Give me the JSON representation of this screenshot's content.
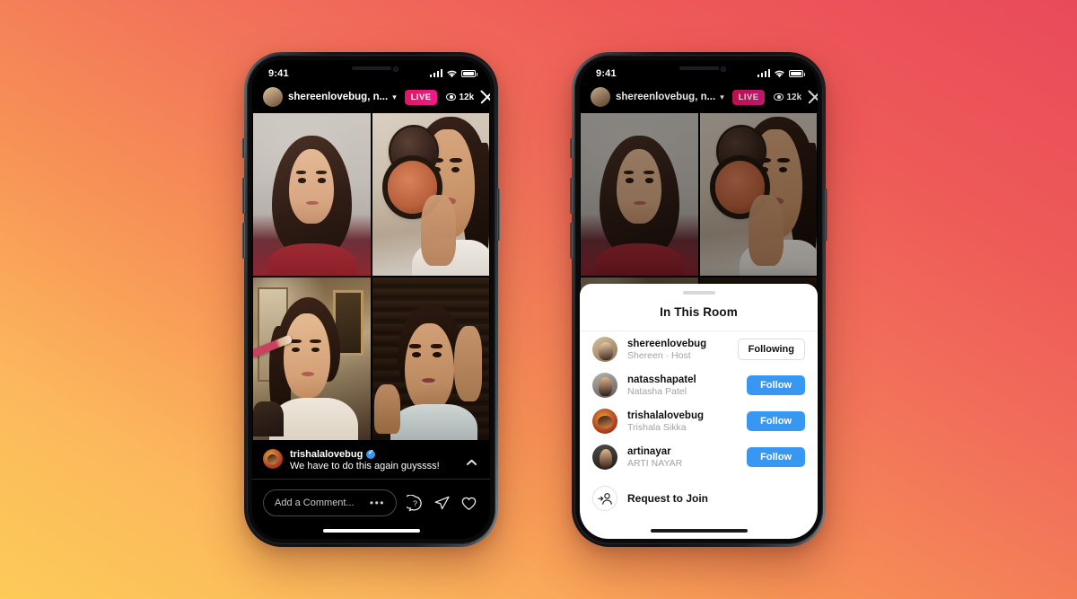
{
  "background": {
    "gradient_from": "#fdcb58",
    "gradient_to": "#e94a5a"
  },
  "accent": {
    "live_badge": "#ee1b8d",
    "follow_blue": "#3897f0",
    "verified_blue": "#3897f0"
  },
  "phones": [
    {
      "id": "left-phone",
      "status_bar": {
        "time": "9:41",
        "signal": "signal-bars-icon",
        "wifi": "wifi-icon",
        "battery": "battery-icon"
      },
      "live_header": {
        "avatar": "host-avatar",
        "username": "shereenlovebug, n...",
        "chevron": "chevron-down-icon",
        "live_label": "LIVE",
        "viewer_icon": "eye-icon",
        "viewer_count": "12k",
        "close": "close-icon"
      },
      "grid": [
        {
          "name": "participant-tile-1",
          "alt": "woman in red top, light wall"
        },
        {
          "name": "participant-tile-2",
          "alt": "woman holding makeup compact"
        },
        {
          "name": "participant-tile-3",
          "alt": "woman applying eye makeup with brush"
        },
        {
          "name": "participant-tile-4",
          "alt": "woman touching brow, dark blinds"
        }
      ],
      "comment": {
        "avatar": "commenter-avatar",
        "username": "trishalalovebug",
        "verified": true,
        "text": "We have to do this again guyssss!",
        "collapse": "chevron-up-icon"
      },
      "action_bar": {
        "input_placeholder": "Add a Comment...",
        "more": "ellipsis-icon",
        "icons": [
          "question-circle-icon",
          "share-icon",
          "heart-icon"
        ]
      },
      "home_indicator": "home-indicator"
    },
    {
      "id": "right-phone",
      "status_bar": {
        "time": "9:41",
        "signal": "signal-bars-icon",
        "wifi": "wifi-icon",
        "battery": "battery-icon"
      },
      "live_header": {
        "avatar": "host-avatar",
        "username": "shereenlovebug, n...",
        "chevron": "chevron-down-icon",
        "live_label": "LIVE",
        "viewer_icon": "eye-icon",
        "viewer_count": "12k",
        "close": "close-icon"
      },
      "sheet": {
        "handle": "drag-handle",
        "title": "In This Room",
        "rows": [
          {
            "avatar": "avatar-shereenlovebug",
            "username": "shereenlovebug",
            "subtitle": "Shereen · Host",
            "button": "Following",
            "button_style": "outline"
          },
          {
            "avatar": "avatar-natasshapatel",
            "username": "natasshapatel",
            "subtitle": "Natasha Patel",
            "button": "Follow",
            "button_style": "primary"
          },
          {
            "avatar": "avatar-trishalalovebug",
            "username": "trishalalovebug",
            "subtitle": "Trishala Sikka",
            "button": "Follow",
            "button_style": "primary"
          },
          {
            "avatar": "avatar-artinayar",
            "username": "artinayar",
            "subtitle": "ARTI NAYAR",
            "button": "Follow",
            "button_style": "primary"
          }
        ],
        "join": {
          "icon": "add-person-icon",
          "label": "Request to Join"
        }
      },
      "home_indicator": "home-indicator"
    }
  ]
}
